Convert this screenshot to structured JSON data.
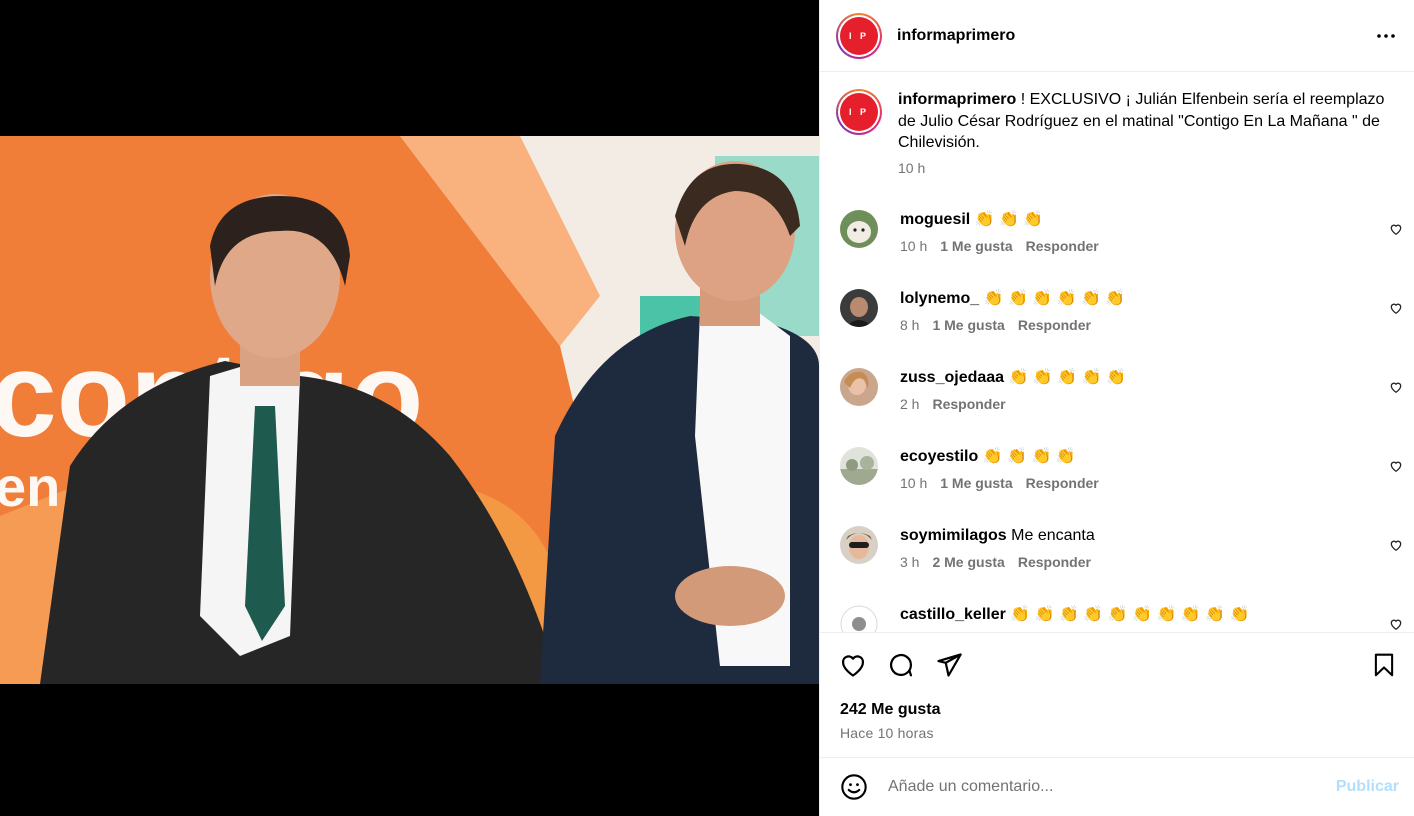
{
  "post": {
    "author": "informaprimero",
    "avatar_text": "I P",
    "caption_text": "! EXCLUSIVO ¡ Julián Elfenbein sería el reemplazo de Julio César Rodríguez en el matinal \"Contigo En La Mañana \" de Chilevisión.",
    "caption_time": "10 h",
    "likes": "242 Me gusta",
    "posted_ago": "Hace 10 horas",
    "image_overlay_text_1": "contigo",
    "image_overlay_text_2": "en la"
  },
  "comments": [
    {
      "user": "moguesil",
      "text": "👏 👏 👏",
      "time": "10 h",
      "likes": "1 Me gusta",
      "reply": "Responder",
      "avatar": "dog-photo"
    },
    {
      "user": "lolynemo_",
      "text": "👏 👏 👏 👏 👏 👏",
      "time": "8 h",
      "likes": "1 Me gusta",
      "reply": "Responder",
      "avatar": "person-photo"
    },
    {
      "user": "zuss_ojedaaa",
      "text": "👏 👏 👏 👏 👏",
      "time": "2 h",
      "likes": "",
      "reply": "Responder",
      "avatar": "selfie-photo"
    },
    {
      "user": "ecoyestilo",
      "text": "👏 👏 👏 👏",
      "time": "10 h",
      "likes": "1 Me gusta",
      "reply": "Responder",
      "avatar": "landscape-photo"
    },
    {
      "user": "soymimilagos",
      "text": "Me encanta",
      "time": "3 h",
      "likes": "2 Me gusta",
      "reply": "Responder",
      "avatar": "woman-photo"
    },
    {
      "user": "castillo_keller",
      "text": "👏 👏 👏 👏 👏 👏 👏 👏 👏 👏",
      "time": "",
      "likes": "",
      "reply": "",
      "avatar": "default-avatar"
    }
  ],
  "add_comment": {
    "placeholder": "Añade un comentario...",
    "publish": "Publicar"
  },
  "icons": {
    "more": "more-options-icon",
    "like": "heart-icon",
    "comment": "comment-icon",
    "share": "share-icon",
    "save": "bookmark-icon",
    "emoji": "emoji-icon"
  },
  "colors": {
    "brand_red": "#e51f2b",
    "muted": "#737373",
    "publish_disabled": "#b2dffc",
    "border": "#efefef"
  }
}
